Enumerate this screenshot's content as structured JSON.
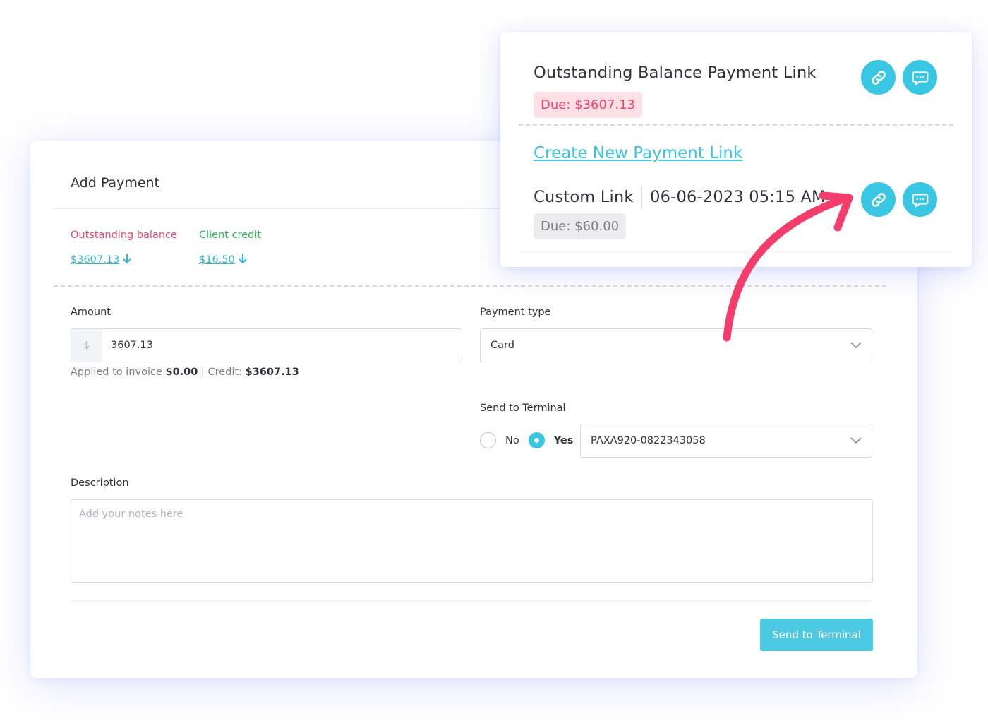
{
  "add_payment": {
    "title": "Add Payment",
    "outstanding_label": "Outstanding balance",
    "outstanding_value": "$3607.13",
    "credit_label": "Client credit",
    "credit_value": "$16.50",
    "amount_label": "Amount",
    "amount_prefix": "$",
    "amount_value": "3607.13",
    "applied_prefix": "Applied to invoice ",
    "applied_invoice": "$0.00",
    "applied_mid": " | Credit: ",
    "applied_credit": "$3607.13",
    "payment_type_label": "Payment type",
    "payment_type_value": "Card",
    "send_terminal_label": "Send to Terminal",
    "radio_no": "No",
    "radio_yes": "Yes",
    "radio_selected": "Yes",
    "terminal_value": "PAXA920-0822343058",
    "description_label": "Description",
    "description_placeholder": "Add your notes here",
    "send_button": "Send to Terminal"
  },
  "payment_links": {
    "outstanding_title": "Outstanding Balance Payment Link",
    "outstanding_due": "Due: $3607.13",
    "create_link": "Create New Payment Link",
    "custom_label": "Custom Link",
    "custom_date": "06-06-2023 05:15 AM",
    "custom_due": "Due: $60.00"
  },
  "icons": {
    "link": "link-icon",
    "message": "message-icon",
    "arrow_down": "arrow-down-icon",
    "chevron": "chevron-down-icon",
    "annotation_arrow": "curved-arrow-annotation"
  },
  "colors": {
    "accent": "#39c6e2",
    "outstanding": "#f0446e",
    "credit": "#1fba4f",
    "annotation_arrow": "#f43d6b"
  }
}
